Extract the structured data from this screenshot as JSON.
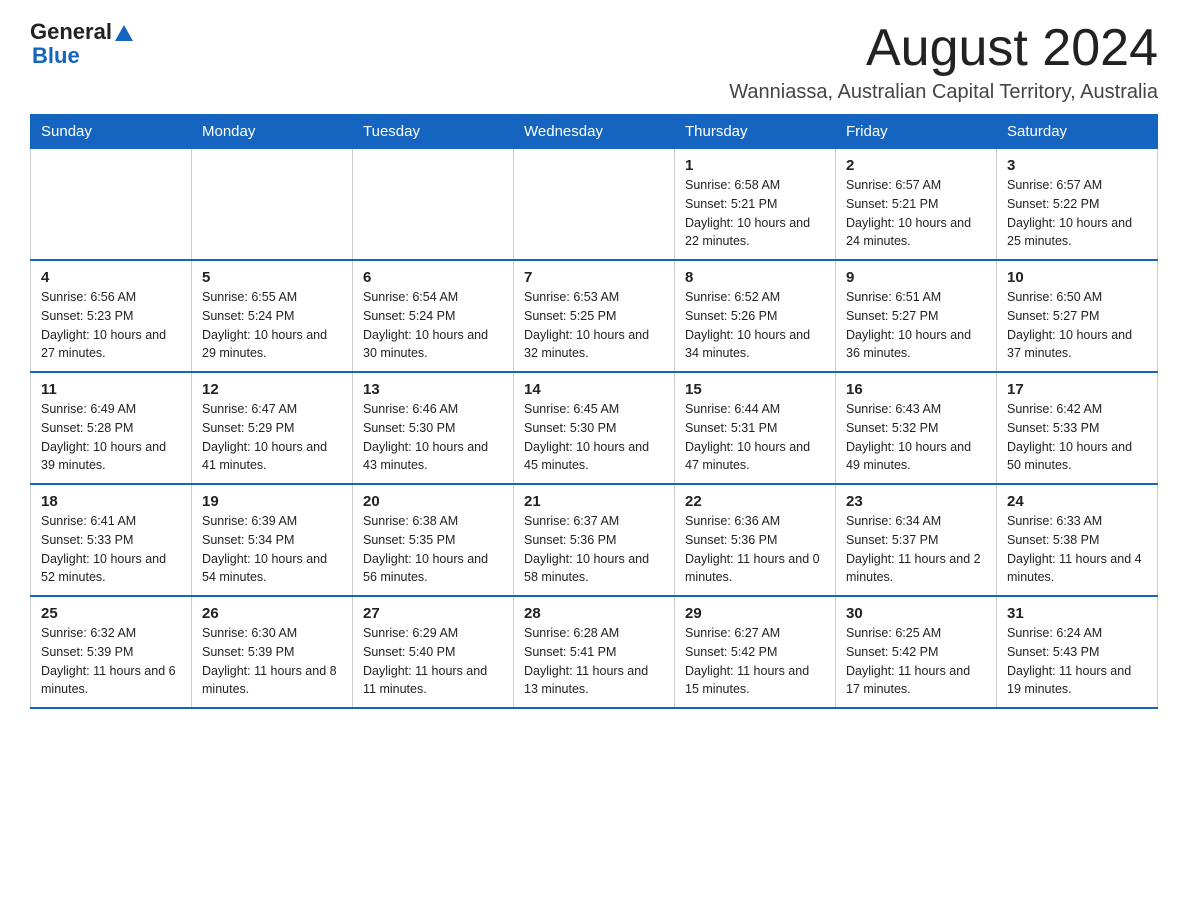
{
  "logo": {
    "general": "General",
    "blue": "Blue"
  },
  "header": {
    "month_year": "August 2024",
    "location": "Wanniassa, Australian Capital Territory, Australia"
  },
  "days_of_week": [
    "Sunday",
    "Monday",
    "Tuesday",
    "Wednesday",
    "Thursday",
    "Friday",
    "Saturday"
  ],
  "weeks": [
    [
      {
        "day": "",
        "info": ""
      },
      {
        "day": "",
        "info": ""
      },
      {
        "day": "",
        "info": ""
      },
      {
        "day": "",
        "info": ""
      },
      {
        "day": "1",
        "info": "Sunrise: 6:58 AM\nSunset: 5:21 PM\nDaylight: 10 hours and 22 minutes."
      },
      {
        "day": "2",
        "info": "Sunrise: 6:57 AM\nSunset: 5:21 PM\nDaylight: 10 hours and 24 minutes."
      },
      {
        "day": "3",
        "info": "Sunrise: 6:57 AM\nSunset: 5:22 PM\nDaylight: 10 hours and 25 minutes."
      }
    ],
    [
      {
        "day": "4",
        "info": "Sunrise: 6:56 AM\nSunset: 5:23 PM\nDaylight: 10 hours and 27 minutes."
      },
      {
        "day": "5",
        "info": "Sunrise: 6:55 AM\nSunset: 5:24 PM\nDaylight: 10 hours and 29 minutes."
      },
      {
        "day": "6",
        "info": "Sunrise: 6:54 AM\nSunset: 5:24 PM\nDaylight: 10 hours and 30 minutes."
      },
      {
        "day": "7",
        "info": "Sunrise: 6:53 AM\nSunset: 5:25 PM\nDaylight: 10 hours and 32 minutes."
      },
      {
        "day": "8",
        "info": "Sunrise: 6:52 AM\nSunset: 5:26 PM\nDaylight: 10 hours and 34 minutes."
      },
      {
        "day": "9",
        "info": "Sunrise: 6:51 AM\nSunset: 5:27 PM\nDaylight: 10 hours and 36 minutes."
      },
      {
        "day": "10",
        "info": "Sunrise: 6:50 AM\nSunset: 5:27 PM\nDaylight: 10 hours and 37 minutes."
      }
    ],
    [
      {
        "day": "11",
        "info": "Sunrise: 6:49 AM\nSunset: 5:28 PM\nDaylight: 10 hours and 39 minutes."
      },
      {
        "day": "12",
        "info": "Sunrise: 6:47 AM\nSunset: 5:29 PM\nDaylight: 10 hours and 41 minutes."
      },
      {
        "day": "13",
        "info": "Sunrise: 6:46 AM\nSunset: 5:30 PM\nDaylight: 10 hours and 43 minutes."
      },
      {
        "day": "14",
        "info": "Sunrise: 6:45 AM\nSunset: 5:30 PM\nDaylight: 10 hours and 45 minutes."
      },
      {
        "day": "15",
        "info": "Sunrise: 6:44 AM\nSunset: 5:31 PM\nDaylight: 10 hours and 47 minutes."
      },
      {
        "day": "16",
        "info": "Sunrise: 6:43 AM\nSunset: 5:32 PM\nDaylight: 10 hours and 49 minutes."
      },
      {
        "day": "17",
        "info": "Sunrise: 6:42 AM\nSunset: 5:33 PM\nDaylight: 10 hours and 50 minutes."
      }
    ],
    [
      {
        "day": "18",
        "info": "Sunrise: 6:41 AM\nSunset: 5:33 PM\nDaylight: 10 hours and 52 minutes."
      },
      {
        "day": "19",
        "info": "Sunrise: 6:39 AM\nSunset: 5:34 PM\nDaylight: 10 hours and 54 minutes."
      },
      {
        "day": "20",
        "info": "Sunrise: 6:38 AM\nSunset: 5:35 PM\nDaylight: 10 hours and 56 minutes."
      },
      {
        "day": "21",
        "info": "Sunrise: 6:37 AM\nSunset: 5:36 PM\nDaylight: 10 hours and 58 minutes."
      },
      {
        "day": "22",
        "info": "Sunrise: 6:36 AM\nSunset: 5:36 PM\nDaylight: 11 hours and 0 minutes."
      },
      {
        "day": "23",
        "info": "Sunrise: 6:34 AM\nSunset: 5:37 PM\nDaylight: 11 hours and 2 minutes."
      },
      {
        "day": "24",
        "info": "Sunrise: 6:33 AM\nSunset: 5:38 PM\nDaylight: 11 hours and 4 minutes."
      }
    ],
    [
      {
        "day": "25",
        "info": "Sunrise: 6:32 AM\nSunset: 5:39 PM\nDaylight: 11 hours and 6 minutes."
      },
      {
        "day": "26",
        "info": "Sunrise: 6:30 AM\nSunset: 5:39 PM\nDaylight: 11 hours and 8 minutes."
      },
      {
        "day": "27",
        "info": "Sunrise: 6:29 AM\nSunset: 5:40 PM\nDaylight: 11 hours and 11 minutes."
      },
      {
        "day": "28",
        "info": "Sunrise: 6:28 AM\nSunset: 5:41 PM\nDaylight: 11 hours and 13 minutes."
      },
      {
        "day": "29",
        "info": "Sunrise: 6:27 AM\nSunset: 5:42 PM\nDaylight: 11 hours and 15 minutes."
      },
      {
        "day": "30",
        "info": "Sunrise: 6:25 AM\nSunset: 5:42 PM\nDaylight: 11 hours and 17 minutes."
      },
      {
        "day": "31",
        "info": "Sunrise: 6:24 AM\nSunset: 5:43 PM\nDaylight: 11 hours and 19 minutes."
      }
    ]
  ]
}
